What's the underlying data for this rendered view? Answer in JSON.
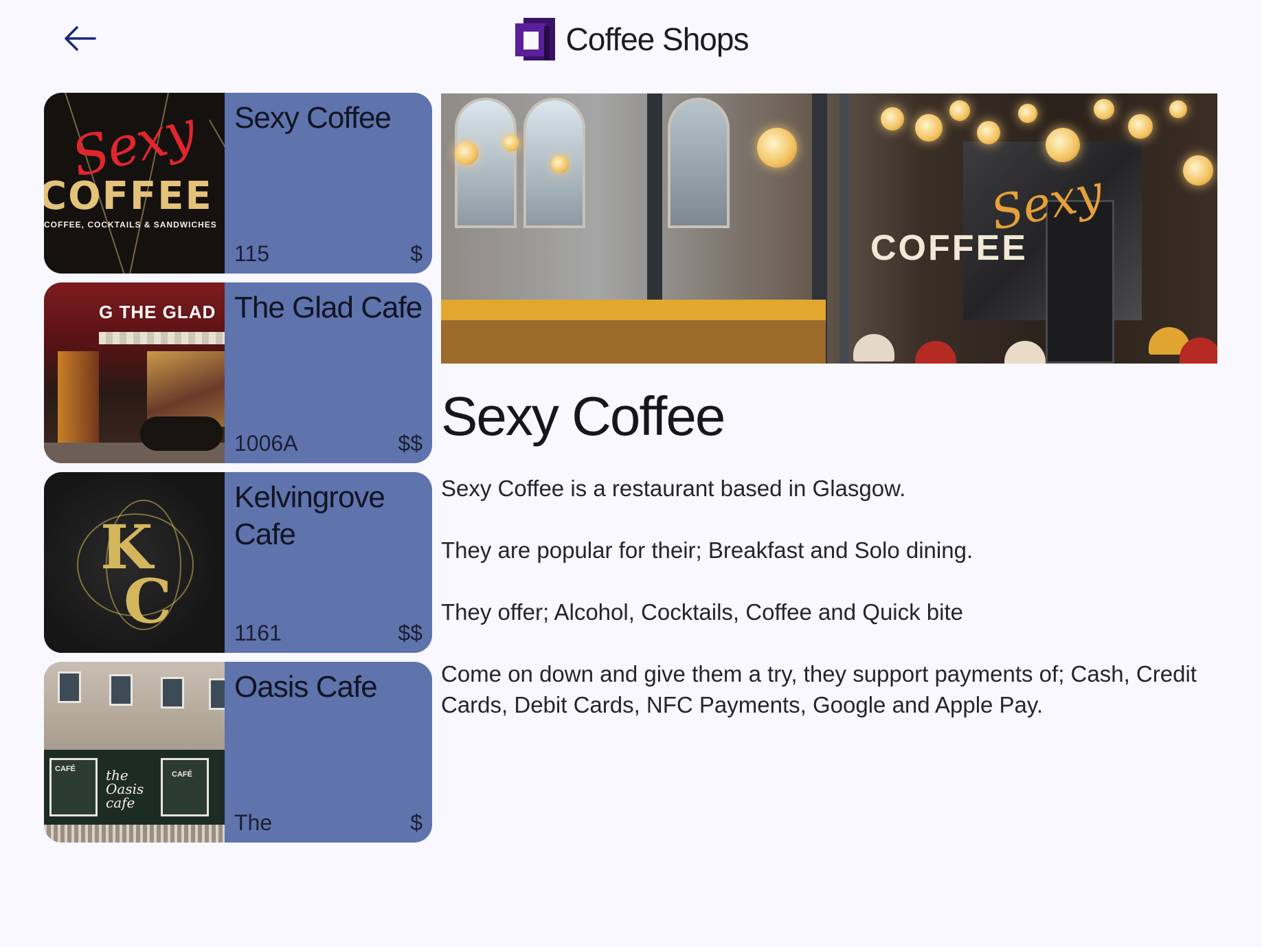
{
  "header": {
    "title": "Coffee Shops",
    "back_icon": "arrow-left-icon",
    "logo_icon": "app-logo-icon",
    "accent_color": "#5a1f9a"
  },
  "shops": [
    {
      "name": "Sexy Coffee",
      "code": "115",
      "price": "$",
      "thumb_text": {
        "script": "Sexy",
        "word": "COFFEE",
        "tag": "COFFEE, COCKTAILS & SANDWICHES"
      }
    },
    {
      "name": "The Glad Cafe",
      "code": "1006A",
      "price": "$$",
      "thumb_text": {
        "sign": "G THE GLAD"
      }
    },
    {
      "name": "Kelvingrove Cafe",
      "code": "1161",
      "price": "$$",
      "thumb_text": {
        "top": "K",
        "bottom": "C"
      }
    },
    {
      "name": "Oasis Cafe",
      "code": "The",
      "price": "$",
      "thumb_text": {
        "left": "CAFÉ",
        "center": "the Oasis cafe",
        "right": "CAFÉ"
      }
    }
  ],
  "card_color": "#5f73ad",
  "detail": {
    "title": "Sexy Coffee",
    "hero_sign_script": "Sexy",
    "hero_sign_word": "COFFEE",
    "paragraphs": [
      "Sexy Coffee is a restaurant based in Glasgow.",
      "They are popular for their; Breakfast and Solo dining.",
      "They offer; Alcohol, Cocktails, Coffee and Quick bite",
      "Come on down and give them a try, they support payments of; Cash, Credit Cards, Debit Cards, NFC Payments, Google and Apple Pay."
    ]
  }
}
